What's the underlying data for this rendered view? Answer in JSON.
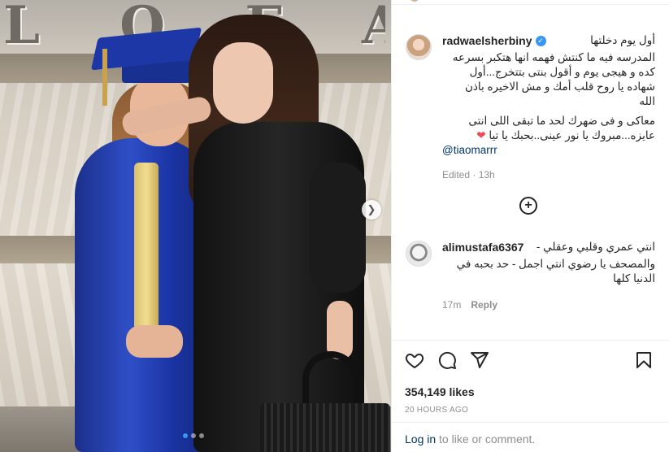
{
  "photo": {
    "wall_letters": "L O F A",
    "next_icon": "chevron-right-icon",
    "carousel_dots": 3,
    "active_dot": 1
  },
  "post": {
    "author": "radwaelsherbiny",
    "verified": true,
    "caption_lines": [
      "أول يوم دخلتها",
      "المدرسه فيه ما كنتش فهمه انها هتكبر بسرعه",
      "كده و هيجى يوم و أقول بنتى بتتخرج...أول",
      "شهاده يا روح قلب أمك و مش الاخيره باذن",
      "الله",
      "معاكى و فى ضهرك لحد ما تبقى اللى انتى",
      "عايزه...مبروك يا نور عينى..بحبك يا تيا"
    ],
    "heart": "❤",
    "mention": "@tiaomarrr",
    "edited_label": "Edited · 13h",
    "load_more_icon": "plus-circle-icon"
  },
  "comment": {
    "username": "alimustafa6367",
    "lines": [
      "انتي عمري وقلبي وعقلي -",
      "والمصحف يا رضوي انتي اجمل - حد بحبه في",
      "الدنيا كلها"
    ],
    "time": "17m",
    "reply_label": "Reply"
  },
  "actions": {
    "like_icon": "heart-icon",
    "comment_icon": "comment-icon",
    "share_icon": "share-icon",
    "save_icon": "bookmark-icon",
    "likes": "354,149 likes",
    "timestamp": "20 HOURS AGO",
    "login_link": "Log in",
    "login_rest": " to like or comment."
  },
  "colors": {
    "link": "#00376b",
    "verified": "#3897f0",
    "muted": "#8e8e8e",
    "text": "#262626",
    "heart": "#ed4956"
  }
}
